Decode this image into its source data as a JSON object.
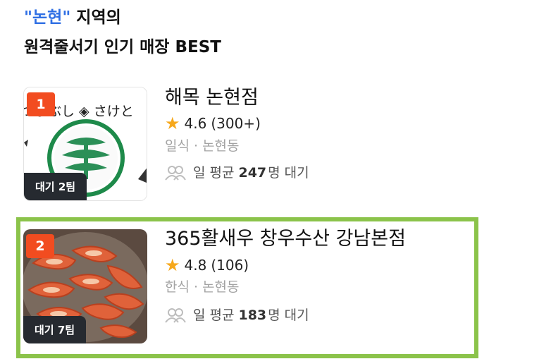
{
  "header": {
    "quote_open": "\"",
    "region": "논현",
    "quote_close": "\"",
    "region_suffix": " 지역의",
    "subtitle": "원격줄서기 인기 매장 BEST"
  },
  "stores": [
    {
      "rank": "1",
      "wait_badge": "대기 2팀",
      "name": "해목 논현점",
      "rating": "4.6",
      "review_count": "(300+)",
      "category_location": "일식 · 논현동",
      "avg_prefix": "일 평균",
      "avg_count": "247",
      "avg_suffix": "명 대기",
      "sign_text": "つまぶし ◈ さけと"
    },
    {
      "rank": "2",
      "wait_badge": "대기 7팀",
      "name": "365활새우 창우수산 강남본점",
      "rating": "4.8",
      "review_count": "(106)",
      "category_location": "한식 · 논현동",
      "avg_prefix": "일 평균",
      "avg_count": "183",
      "avg_suffix": "명 대기"
    }
  ],
  "colors": {
    "accent": "#2f6fe4",
    "rank_badge": "#f24c20",
    "wait_badge": "#262a30",
    "star": "#f6a81c",
    "highlight_frame": "#8bc34a",
    "meta_gray": "#a3a3a3"
  },
  "icons": [
    "star-icon",
    "people-icon"
  ]
}
